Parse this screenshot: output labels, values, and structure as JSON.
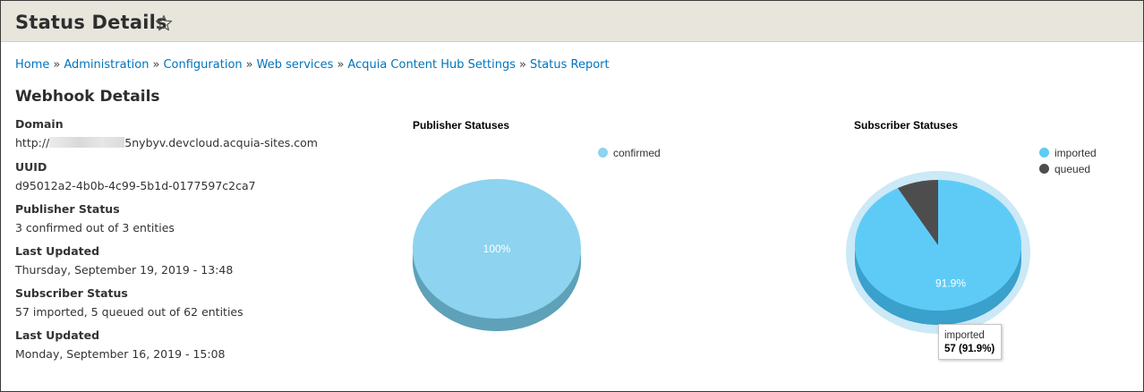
{
  "header": {
    "title": "Status Details",
    "star_icon": "star-outline-icon"
  },
  "breadcrumb": {
    "separator": "»",
    "items": [
      "Home",
      "Administration",
      "Configuration",
      "Web services",
      "Acquia Content Hub Settings",
      "Status Report"
    ]
  },
  "webhook": {
    "title": "Webhook Details",
    "fields": [
      {
        "label": "Domain",
        "value_prefix": "http://",
        "value_suffix": "5nybyv.devcloud.acquia-sites.com",
        "redacted": true
      },
      {
        "label": "UUID",
        "value": "d95012a2-4b0b-4c99-5b1d-0177597c2ca7"
      },
      {
        "label": "Publisher Status",
        "value": "3 confirmed out of 3 entities"
      },
      {
        "label": "Last Updated",
        "value": "Thursday, September 19, 2019 - 13:48"
      },
      {
        "label": "Subscriber Status",
        "value": "57 imported, 5 queued out of 62 entities"
      },
      {
        "label": "Last Updated",
        "value": "Monday, September 16, 2019 - 15:08"
      }
    ]
  },
  "colors": {
    "link": "#0074bd",
    "confirmed": "#8ed3ef",
    "confirmed_side": "#5ea1b8",
    "imported": "#5ecbf7",
    "imported_side": "#3aa0cc",
    "queued": "#4d4d4d",
    "queued_side": "#2f2f2f",
    "halo": "#cbe9f6"
  },
  "chart_data": [
    {
      "type": "pie",
      "title": "Publisher Statuses",
      "labels": [
        "confirmed"
      ],
      "values": [
        3
      ],
      "data_labels": [
        "100%"
      ],
      "legend": "top-right"
    },
    {
      "type": "pie",
      "title": "Subscriber Statuses",
      "labels": [
        "imported",
        "queued"
      ],
      "values": [
        57,
        5
      ],
      "data_labels": [
        "91.9%",
        ""
      ],
      "legend": "top-right",
      "tooltip": {
        "label": "imported",
        "value": "57 (91.9%)"
      }
    }
  ]
}
